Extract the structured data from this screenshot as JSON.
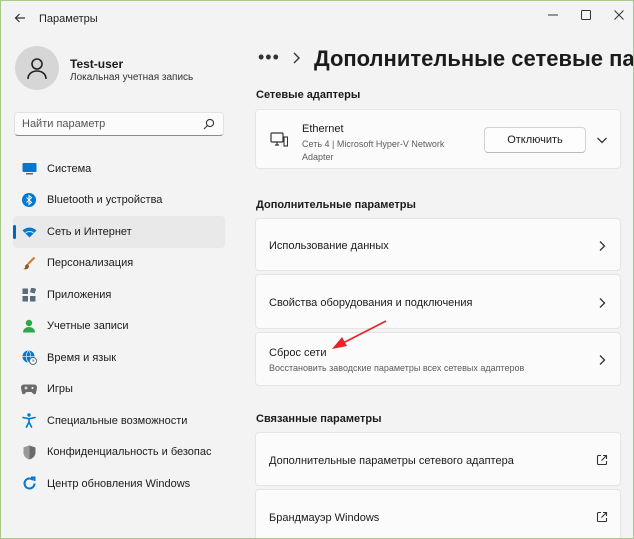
{
  "window": {
    "title": "Параметры",
    "controls": [
      "minimize-icon",
      "maximize-icon",
      "close-icon"
    ]
  },
  "profile": {
    "name": "Test-user",
    "account_type": "Локальная учетная запись"
  },
  "search": {
    "placeholder": "Найти параметр"
  },
  "sidebar": {
    "items": [
      {
        "label": "Система",
        "icon": "monitor-icon",
        "color": "#0078d4"
      },
      {
        "label": "Bluetooth и устройства",
        "icon": "bluetooth-icon",
        "color": "#0078d4"
      },
      {
        "label": "Сеть и Интернет",
        "icon": "wifi-icon",
        "color": "#0078d4",
        "active": true
      },
      {
        "label": "Персонализация",
        "icon": "brush-icon",
        "color": "#d97b2b"
      },
      {
        "label": "Приложения",
        "icon": "apps-icon",
        "color": "#5a6b7d"
      },
      {
        "label": "Учетные записи",
        "icon": "person-icon",
        "color": "#2aa84a"
      },
      {
        "label": "Время и язык",
        "icon": "globe-clock-icon",
        "color": "#0078d4"
      },
      {
        "label": "Игры",
        "icon": "gamepad-icon",
        "color": "#6b6b6b"
      },
      {
        "label": "Специальные возможности",
        "icon": "accessibility-icon",
        "color": "#0078d4"
      },
      {
        "label": "Конфиденциальность и безопас",
        "icon": "shield-icon",
        "color": "#6b6b6b"
      },
      {
        "label": "Центр обновления Windows",
        "icon": "update-icon",
        "color": "#0078d4"
      }
    ]
  },
  "main": {
    "breadcrumb_more": "•••",
    "title": "Дополнительные сетевые пара",
    "adapters_section": "Сетевые адаптеры",
    "adapter": {
      "name": "Ethernet",
      "description": "Сеть 4 | Microsoft Hyper-V Network Adapter",
      "button": "Отключить"
    },
    "more_section": "Дополнительные параметры",
    "more_items": [
      {
        "title": "Использование данных",
        "subtitle": ""
      },
      {
        "title": "Свойства оборудования и подключения",
        "subtitle": ""
      },
      {
        "title": "Сброс сети",
        "subtitle": "Восстановить заводские параметры всех сетевых адаптеров"
      }
    ],
    "related_section": "Связанные параметры",
    "related_items": [
      {
        "title": "Дополнительные параметры сетевого адаптера"
      },
      {
        "title": "Брандмауэр Windows"
      }
    ]
  },
  "colors": {
    "accent": "#0067c0",
    "annotation_arrow": "#e8232a"
  }
}
